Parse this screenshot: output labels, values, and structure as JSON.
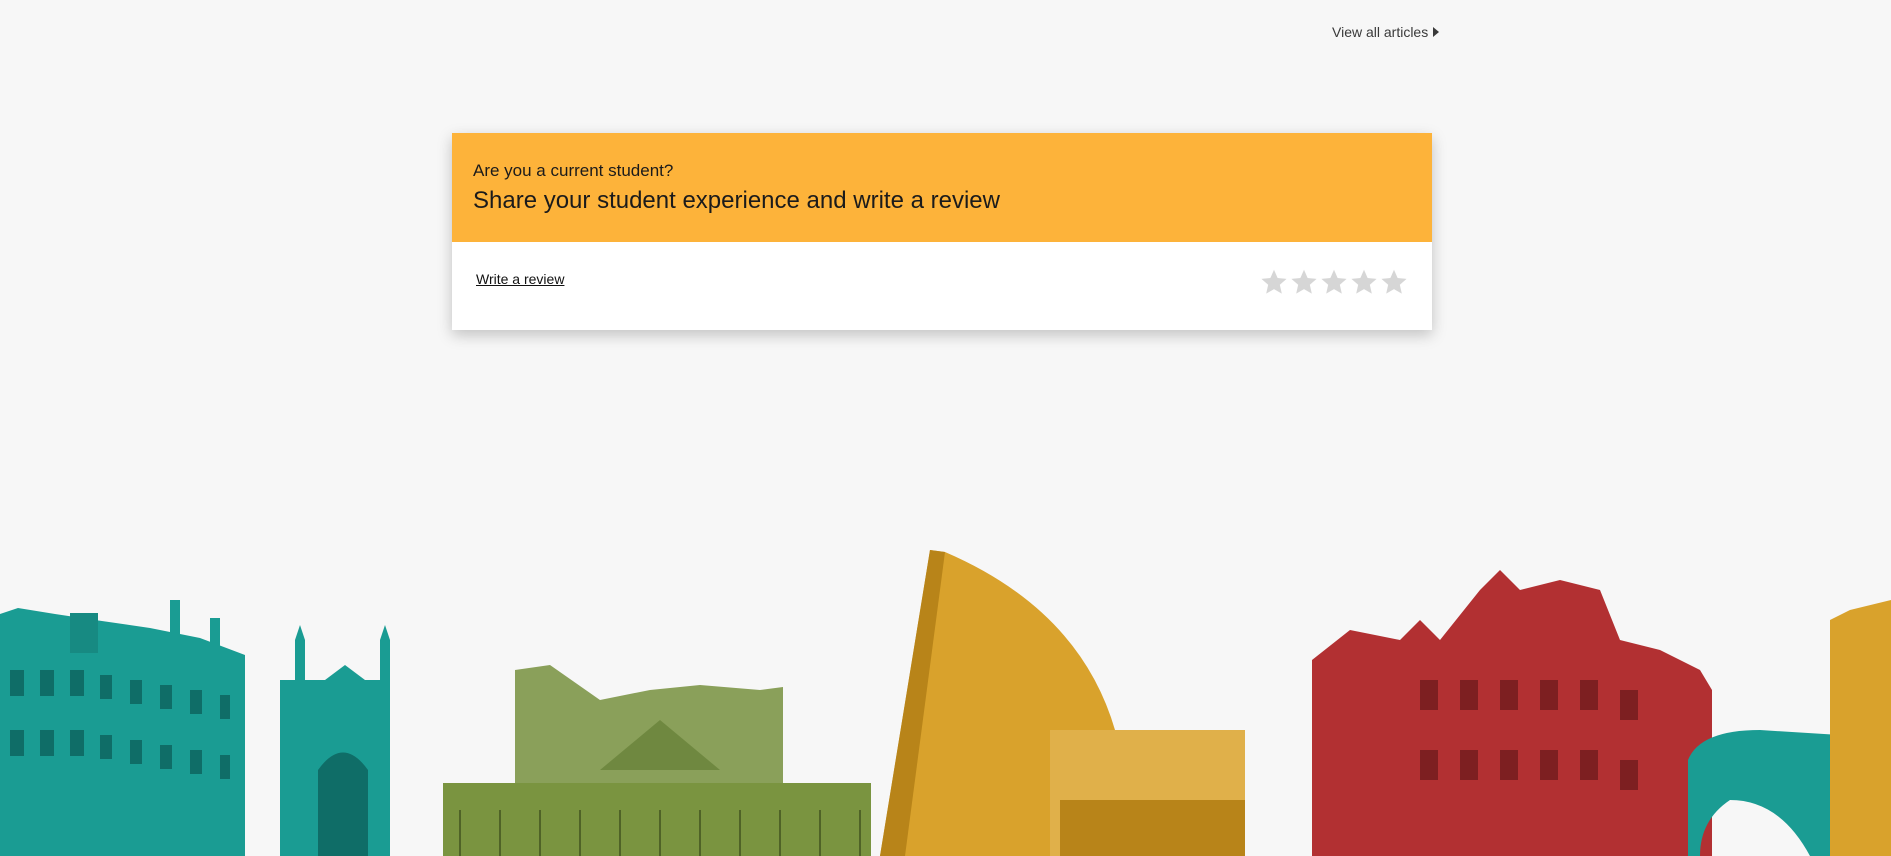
{
  "links": {
    "view_all_articles": "View all articles"
  },
  "review_card": {
    "question": "Are you a current student?",
    "heading": "Share your student experience and write a review",
    "write_review_label": "Write a review",
    "rating": {
      "max": 5,
      "value": 0,
      "empty_color": "#d6d6d6"
    }
  },
  "colors": {
    "page_background": "#f7f7f7",
    "card_header": "#fdb33a",
    "skyline_teal": "#1a9c93",
    "skyline_green": "#7a9440",
    "skyline_gold": "#d9a22c",
    "skyline_red": "#b23032"
  },
  "icons": {
    "view_all_arrow": "caret-right-icon",
    "rating": "star-icon"
  }
}
